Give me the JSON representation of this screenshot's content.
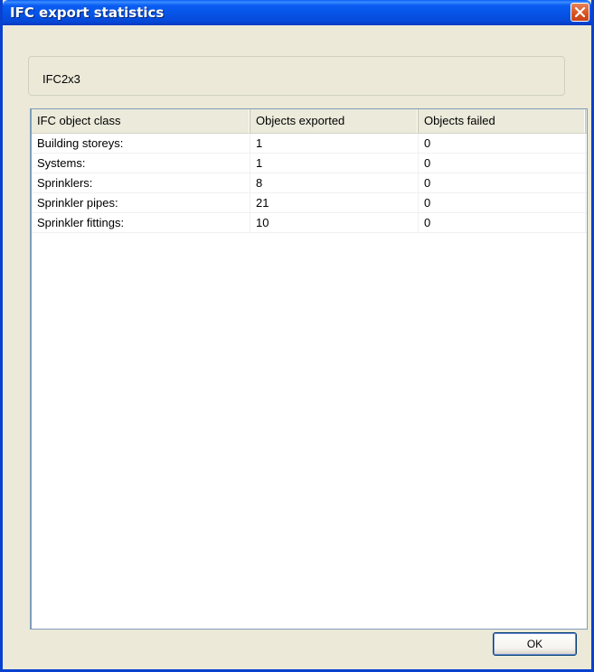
{
  "window": {
    "title": "IFC export statistics"
  },
  "version_box": {
    "text": "IFC2x3"
  },
  "table": {
    "columns": [
      "IFC object class",
      "Objects exported",
      "Objects failed"
    ],
    "rows": [
      [
        "Building storeys:",
        "1",
        "0"
      ],
      [
        "Systems:",
        "1",
        "0"
      ],
      [
        "Sprinklers:",
        "8",
        "0"
      ],
      [
        "Sprinkler pipes:",
        "21",
        "0"
      ],
      [
        "Sprinkler fittings:",
        "10",
        "0"
      ]
    ]
  },
  "buttons": {
    "ok_label": "OK"
  },
  "icons": {
    "close": "close-icon"
  },
  "colors": {
    "titlebar": "#0653e6",
    "close_button": "#d9511d",
    "window_face": "#ece9d8"
  }
}
